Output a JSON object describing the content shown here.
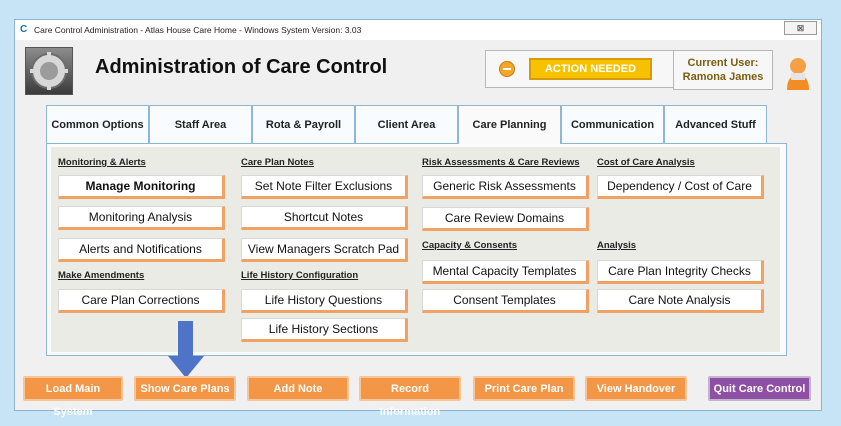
{
  "window": {
    "title": "Care Control Administration - Atlas House Care Home - Windows System Version: 3.03",
    "app_icon": "C",
    "close_symbol": "⊠"
  },
  "header": {
    "title": "Administration of Care Control",
    "status": {
      "label": "ACTION NEEDED",
      "icon": "minus-circle-icon"
    },
    "user": {
      "label": "Current User:",
      "name": "Ramona James"
    }
  },
  "tabs": [
    {
      "label": "Common Options",
      "active": false
    },
    {
      "label": "Staff Area",
      "active": false
    },
    {
      "label": "Rota & Payroll",
      "active": false
    },
    {
      "label": "Client Area",
      "active": false
    },
    {
      "label": "Care Planning",
      "active": true
    },
    {
      "label": "Communication Area",
      "active": false
    },
    {
      "label": "Advanced Stuff",
      "active": false
    }
  ],
  "sections": {
    "monitoring": {
      "heading": "Monitoring & Alerts",
      "buttons": [
        "Manage Monitoring",
        "Monitoring Analysis",
        "Alerts and Notifications"
      ]
    },
    "amendments": {
      "heading": "Make Amendments",
      "buttons": [
        "Care Plan Corrections"
      ]
    },
    "care_notes": {
      "heading": "Care Plan Notes",
      "buttons": [
        "Set Note Filter Exclusions",
        "Shortcut Notes",
        "View Managers Scratch Pad"
      ]
    },
    "life_history": {
      "heading": "Life History Configuration",
      "buttons": [
        "Life History Questions",
        "Life History Sections"
      ]
    },
    "risk": {
      "heading": "Risk Assessments & Care Reviews",
      "buttons": [
        "Generic Risk Assessments",
        "Care Review Domains"
      ]
    },
    "capacity": {
      "heading": "Capacity & Consents",
      "buttons": [
        "Mental Capacity Templates",
        "Consent Templates"
      ]
    },
    "cost": {
      "heading": "Cost of Care Analysis",
      "buttons": [
        "Dependency / Cost of Care"
      ]
    },
    "analysis": {
      "heading": "Analysis",
      "buttons": [
        "Care Plan Integrity Checks",
        "Care Note Analysis"
      ]
    }
  },
  "footer": [
    {
      "label": "Load Main System",
      "color": "#f39645"
    },
    {
      "label": "Show Care Plans",
      "color": "#f39645"
    },
    {
      "label": "Add Note",
      "color": "#f39645"
    },
    {
      "label": "Record Information",
      "color": "#f39645"
    },
    {
      "label": "Print Care Plan",
      "color": "#f39645"
    },
    {
      "label": "View Handover",
      "color": "#f39645"
    },
    {
      "label": "Quit Care Control",
      "color": "#8f4fa4"
    }
  ],
  "colors": {
    "accent": "#f39645",
    "highlight_button": "#f6c200",
    "quit_button": "#8f4fa4",
    "guide_arrow": "#4f74c7"
  }
}
